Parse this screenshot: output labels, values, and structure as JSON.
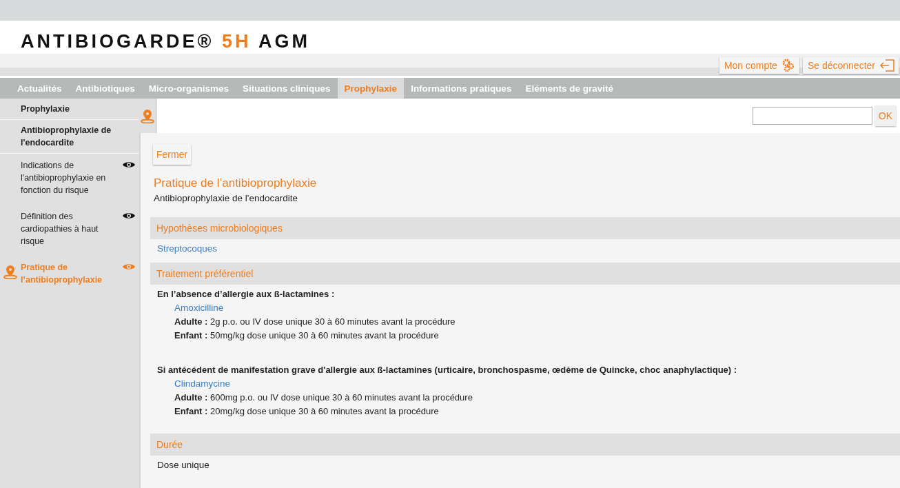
{
  "header": {
    "logo": "ANTIBIOGARDE®",
    "logo_accent": "5H",
    "logo_suffix": "AGM"
  },
  "account_buttons": [
    {
      "label": "Mon compte",
      "kind": "account"
    },
    {
      "label": "Se déconnecter",
      "kind": "logout"
    }
  ],
  "nav": [
    {
      "label": "Actualités",
      "selected": false
    },
    {
      "label": "Antibiotiques",
      "selected": false
    },
    {
      "label": "Micro-organismes",
      "selected": false
    },
    {
      "label": "Situations cliniques",
      "selected": false
    },
    {
      "label": "Prophylaxie",
      "selected": true
    },
    {
      "label": "Informations pratiques",
      "selected": false
    },
    {
      "label": "Eléments de gravité",
      "selected": false
    }
  ],
  "sidebar": {
    "items": [
      {
        "label": "Prophylaxie",
        "kind": "heading",
        "selected": false
      },
      {
        "label": "Antibioprophylaxie de l'endocardite",
        "kind": "heading",
        "selected": false
      },
      {
        "label": "Indications de l'antibioprophylaxie en fonction du risque",
        "kind": "page",
        "selected": false
      },
      {
        "label": "Définition des cardiopathies à haut risque",
        "kind": "page",
        "selected": false
      },
      {
        "label": "Pratique de l’antibioprophylaxie",
        "kind": "page",
        "selected": true
      }
    ]
  },
  "search": {
    "button": "OK"
  },
  "content": {
    "close_button": "Fermer",
    "title": "Pratique de l’antibioprophylaxie",
    "subtitle": "Antibioprophylaxie de l'endocardite",
    "sections": [
      {
        "title": "Hypothèses microbiologiques",
        "kind": "links",
        "links": [
          "Streptocoques"
        ]
      },
      {
        "title": "Traitement préférentiel",
        "kind": "treatment",
        "groups": [
          {
            "condition": "En l’absence d’allergie aux ß-lactamines :",
            "drug": "Amoxicilline",
            "doses": [
              "**Adulte :** 2g p.o. ou IV dose unique 30 à 60 minutes avant la procédure",
              "**Enfant :** 50mg/kg dose unique 30 à 60 minutes avant la procédure"
            ]
          },
          {
            "condition": "Si antécédent de manifestation grave d'allergie aux ß-lactamines (urticaire, bronchospasme, œdème de Quincke, choc anaphylactique) :",
            "drug": "Clindamycine",
            "doses": [
              "**Adulte :** 600mg p.o. ou IV dose unique 30 à 60 minutes avant la procédure",
              "**Enfant :** 20mg/kg dose unique 30 à 60 minutes avant la procédure"
            ]
          }
        ]
      },
      {
        "title": "Durée",
        "kind": "text",
        "text": "Dose unique"
      }
    ]
  }
}
